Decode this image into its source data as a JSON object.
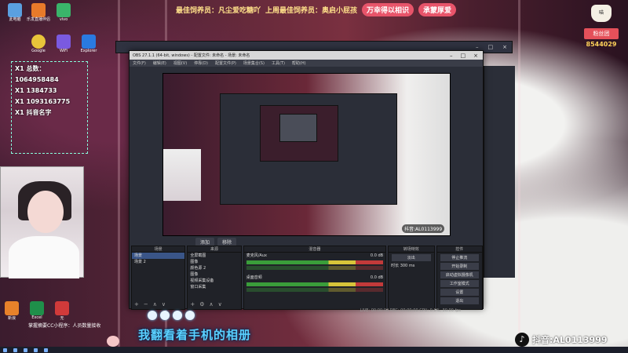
{
  "banner": {
    "item1": "最佳饲养员：凡尘爱吃糖吖",
    "item2": "上周最佳饲养员：奥启小屁孩",
    "pill1": "万幸得以相识",
    "pill2": "承蒙厚爱"
  },
  "overlay_text": [
    "X1 总数：1064958484",
    "X1 1384733",
    "X1 1093163775",
    "X1 抖音名字"
  ],
  "desktop_icons": [
    {
      "label": "此电脑",
      "color": "#5aa0e0"
    },
    {
      "label": "乐发直播伴侣",
      "color": "#e87a2a"
    },
    {
      "label": "vivo",
      "color": "#3ab46a"
    },
    {
      "label": "Google",
      "color": "#e8c43a"
    },
    {
      "label": "WiFi",
      "color": "#7a5ae0"
    },
    {
      "label": "Explorer",
      "color": "#2a7ae0"
    }
  ],
  "brand": {
    "logo_text": "喵",
    "tag": "粉丝团",
    "number": "8544029"
  },
  "obs": {
    "title": "OBS 27.1.1 (64-bit, windows) - 配置文件: 未命名 - 场景: 未命名",
    "menu": [
      "文件(F)",
      "编辑(E)",
      "视图(V)",
      "停靠(D)",
      "配置文件(P)",
      "场景集合(S)",
      "工具(T)",
      "帮助(H)"
    ],
    "preview_label": "抖音:AL0113999",
    "scene_tabs": [
      "添加",
      "移除"
    ],
    "panels": {
      "scenes_header": "场景",
      "scenes": [
        "场景",
        "场景 2"
      ],
      "sources_header": "来源",
      "sources": [
        "全屏截图",
        "图像",
        "颜色源 2",
        "图像",
        "视频采集设备",
        "窗口采集"
      ],
      "mixer_header": "混音器",
      "mixer_items": [
        {
          "name": "麦克风/Aux",
          "level": "0.0 dB"
        },
        {
          "name": "桌面音频",
          "level": "0.0 dB"
        }
      ],
      "transitions_header": "转场特效",
      "transition_value": "淡出",
      "transition_duration_label": "时长",
      "transition_duration": "300 ms",
      "controls_header": "控件",
      "controls": [
        "停止推流",
        "开始录制",
        "启动虚拟摄像机",
        "工作室模式",
        "设置",
        "退出"
      ]
    },
    "status": "LIVE: 00:00:00   REC: 00:00:00   CPU: 0.0%, 30.00 fps"
  },
  "lyric": "我翻看着手机的相册",
  "tiktok_id": "抖音:AL0113999",
  "bottom_apps": [
    {
      "label": "新浪",
      "color": "#e8812a"
    },
    {
      "label": "Excel",
      "color": "#1f8f4a"
    },
    {
      "label": "无",
      "color": "#d03a3a"
    }
  ],
  "mini_note": "掌握摘要CC小程序：人员数量接收"
}
